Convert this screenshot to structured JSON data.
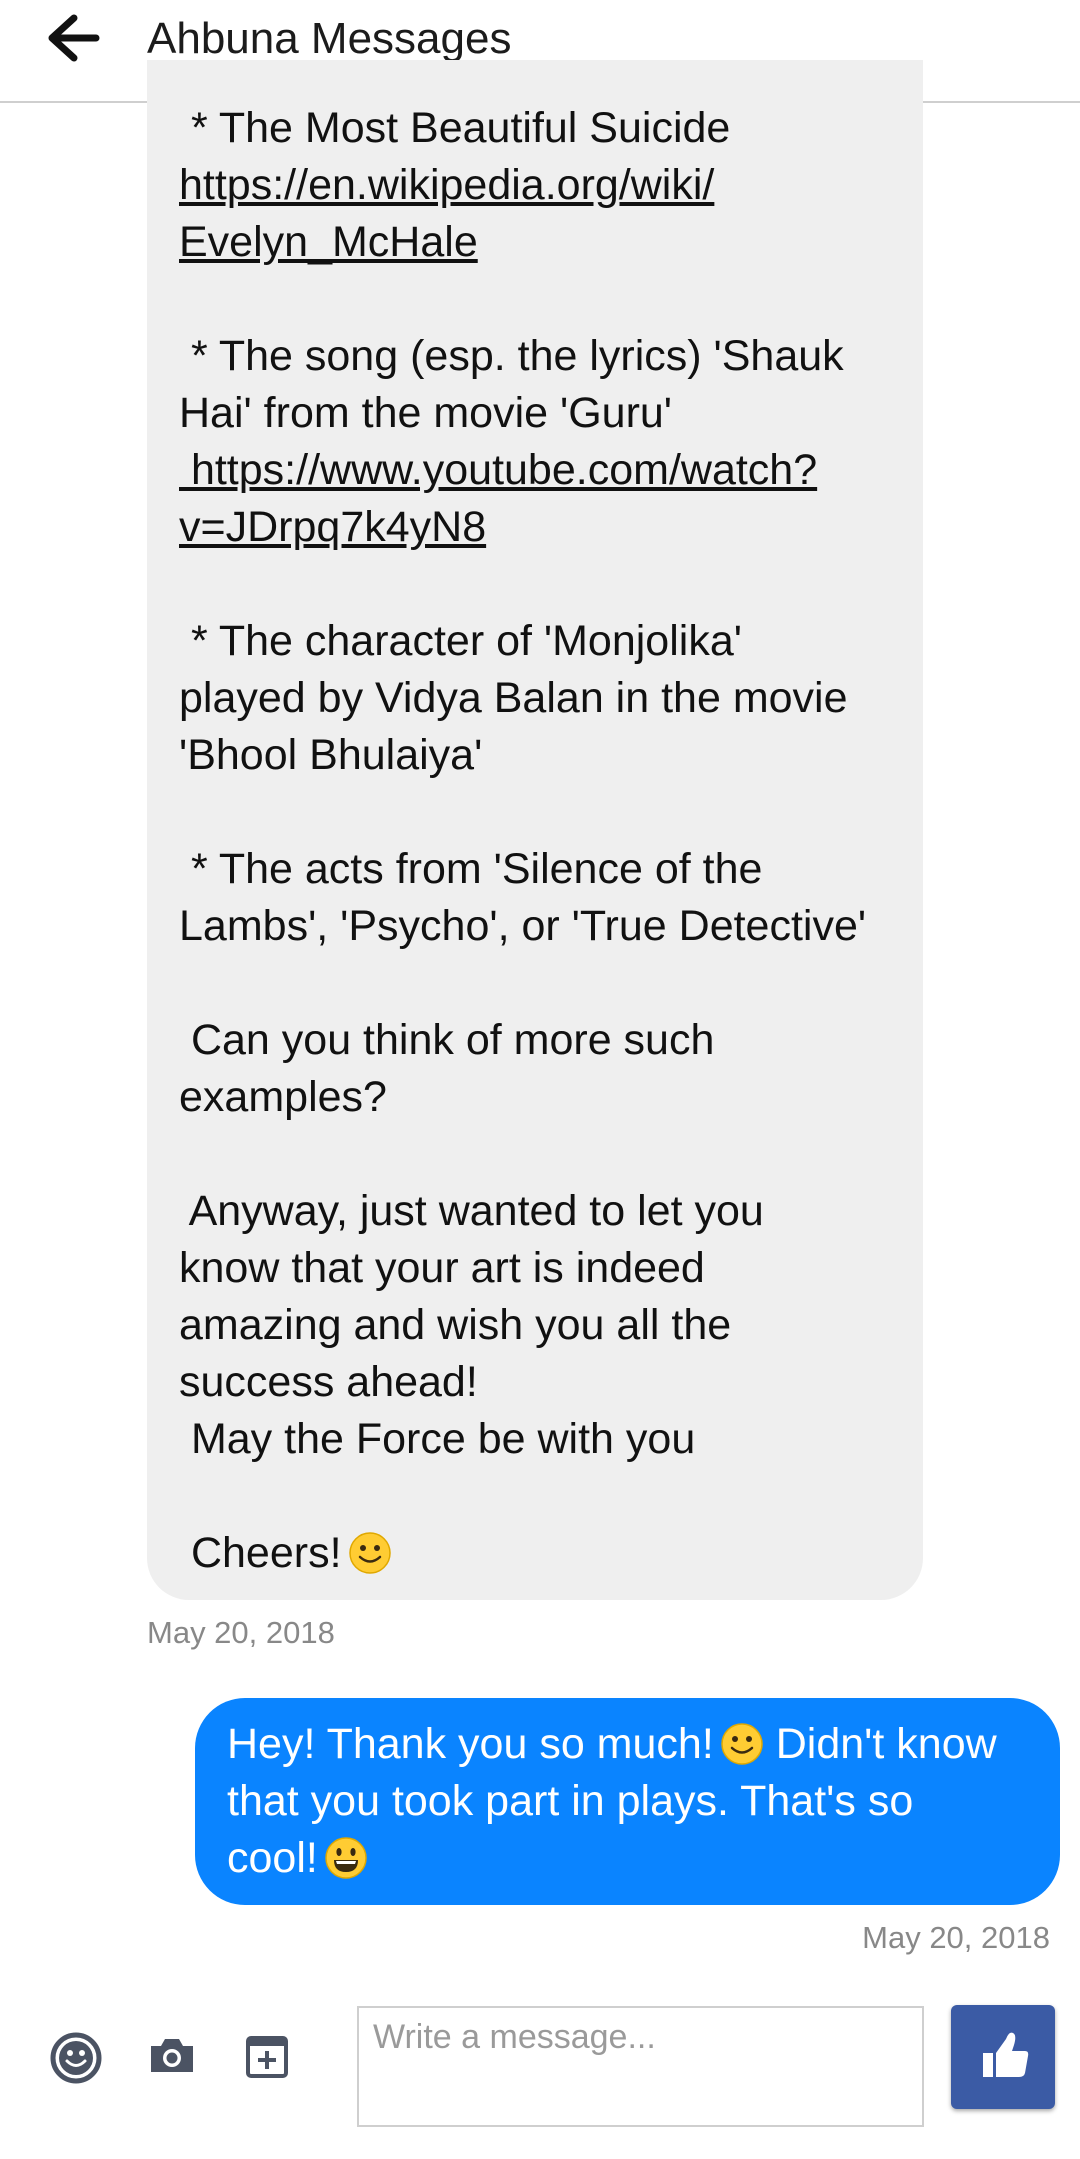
{
  "header": {
    "title": "Ahbuna Messages",
    "back_icon": "arrow-left-icon"
  },
  "received_message": {
    "lines": [
      " * The Most Beautiful Suicide",
      "https://en.wikipedia.org/wiki/",
      "Evelyn_McHale",
      "",
      " * The song (esp. the lyrics) 'Shauk",
      "Hai' from the movie 'Guru'",
      " https://www.youtube.com/watch?",
      "v=JDrpq7k4yN8",
      "",
      " * The character of 'Monjolika'",
      "played by Vidya Balan in the movie",
      "'Bhool Bhulaiya'",
      "",
      " * The acts from 'Silence of the",
      "Lambs', 'Psycho', or 'True Detective'",
      "",
      " Can you think of more such",
      "examples?",
      "",
      " Anyway, just wanted to let you",
      "know that your art is indeed",
      "amazing and wish you all the",
      "success ahead!",
      " May the Force be with you",
      "",
      " Cheers!"
    ],
    "timestamp": "May 20, 2018"
  },
  "sent_message": {
    "line1a": "Hey! Thank you so much!",
    "line1b": "Didn't know",
    "line2": "that you took part in plays. That's so",
    "line3": "cool!",
    "timestamp": "May 20, 2018",
    "bubble_color": "#0a84ff"
  },
  "composer": {
    "placeholder": "Write a message...",
    "emoji_icon": "smiley-face-icon",
    "camera_icon": "camera-icon",
    "attach_icon": "add-attachment-icon",
    "like_icon": "thumbs-up-icon",
    "like_button_color": "#3b5ba5"
  }
}
